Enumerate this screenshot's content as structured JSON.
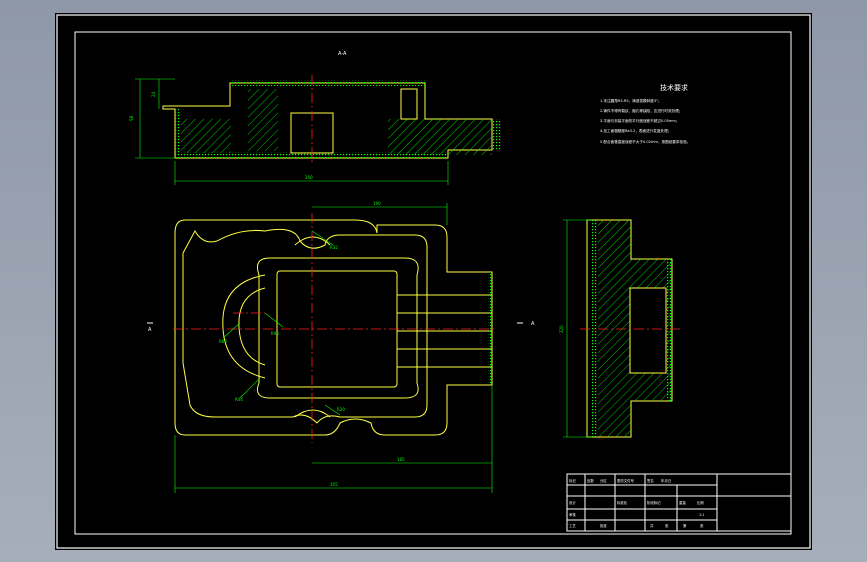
{
  "drawing": {
    "section_label": "A-A",
    "view_arrow_left": "A",
    "view_arrow_right": "A",
    "dimensions": {
      "section_height": "58",
      "section_step": "24",
      "section_width": "350",
      "top_width": "190",
      "bottom_offset": "185",
      "overall_width": "355",
      "side_height": "320",
      "r_upper": "R32",
      "r_mid": "R45",
      "r_left": "R60",
      "r_lower": "R44",
      "r_bottom": "R20"
    },
    "tech_requirements": {
      "title": "技术要求",
      "lines": [
        "1.未注圆角R3-R5，铸造拔模斜度3°；",
        "2.铸件不得有裂纹、缩孔等缺陷，应进行时效处理；",
        "3.平面与安装平面的平行度误差不超过0.05mm；",
        "4.加工面粗糙度Ra3.2，表面进行发蓝处理；",
        "5.配合面垂直度误差不大于0.02mm，按图纸要求检验。"
      ]
    },
    "title_block": {
      "r1": [
        "标记",
        "处数",
        "分区",
        "更改文件号",
        "签名",
        "年月日"
      ],
      "r2": [
        "设计",
        "标准化",
        "阶段标记",
        "重量",
        "比例"
      ],
      "r3": [
        "审核"
      ],
      "r4": [
        "工艺",
        "批准",
        "共",
        "张",
        "第",
        "张"
      ],
      "scale": "1:1"
    }
  }
}
